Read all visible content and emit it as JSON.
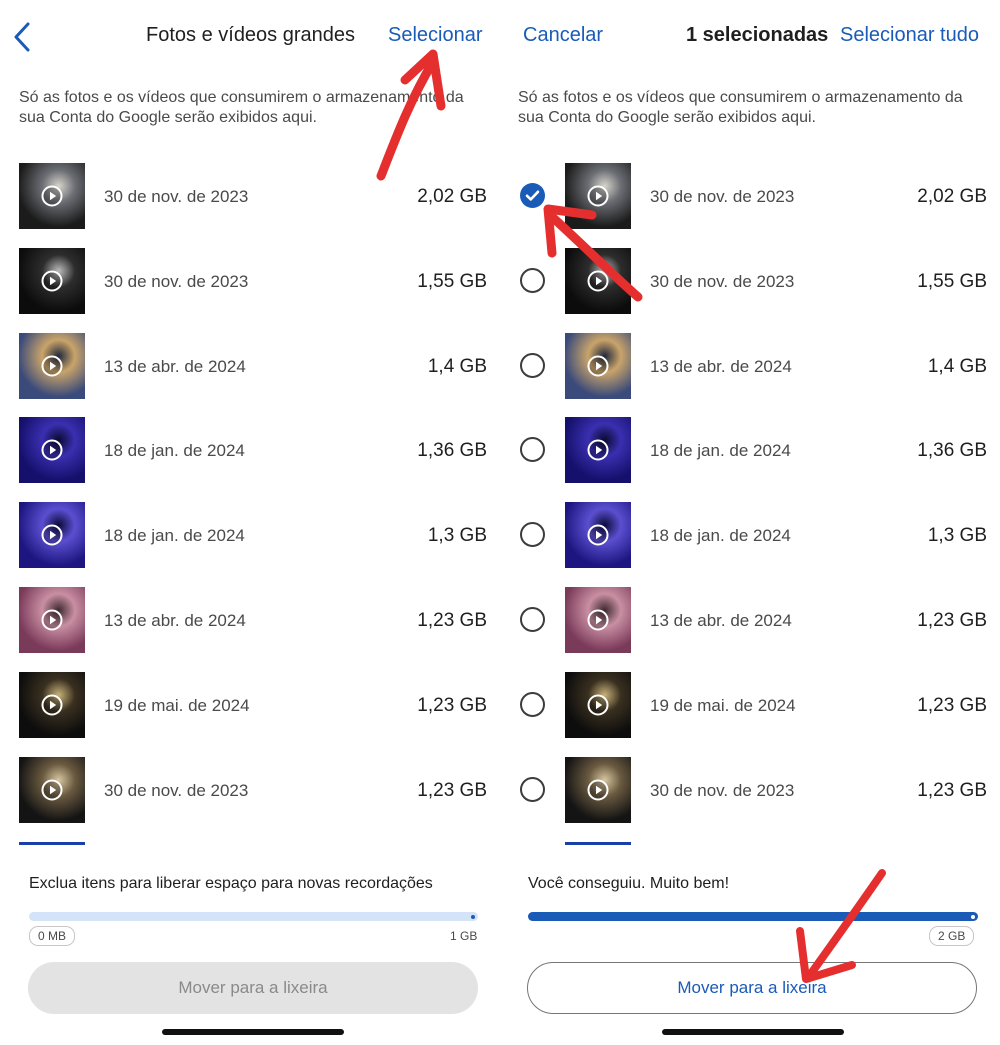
{
  "left": {
    "title": "Fotos e vídeos grandes",
    "select_label": "Selecionar",
    "description": "Só as fotos e os vídeos que consumirem o armazenamento da sua Conta do Google serão exibidos aqui.",
    "status": "Exclua itens para liberar espaço para novas recordações",
    "bar_fill_fraction": 0.0,
    "bar_min_label": "0 MB",
    "bar_max_label": "1 GB",
    "trash_label": "Mover para a lixeira"
  },
  "right": {
    "cancel_label": "Cancelar",
    "title": "1 selecionadas",
    "select_all_label": "Selecionar tudo",
    "description": "Só as fotos e os vídeos que consumirem o armazenamento da sua Conta do Google serão exibidos aqui.",
    "status": "Você conseguiu. Muito bem!",
    "bar_fill_fraction": 1.0,
    "bar_max_label": "2 GB",
    "trash_label": "Mover para a lixeira"
  },
  "items": [
    {
      "date": "30 de nov. de 2023",
      "size": "2,02 GB",
      "selected": true,
      "thumb_colors": [
        "#1b1b1b",
        "#6b6e74",
        "#d8d4cc"
      ]
    },
    {
      "date": "30 de nov. de 2023",
      "size": "1,55 GB",
      "selected": false,
      "thumb_colors": [
        "#0c0c0c",
        "#2d2d2d",
        "#bcbcbc"
      ]
    },
    {
      "date": "13 de abr. de 2024",
      "size": "1,4 GB",
      "selected": false,
      "thumb_colors": [
        "#3a4a7a",
        "#c9a46a",
        "#21283d"
      ]
    },
    {
      "date": "18 de jan. de 2024",
      "size": "1,36 GB",
      "selected": false,
      "thumb_colors": [
        "#14106b",
        "#3a2fb0",
        "#0a0a30"
      ]
    },
    {
      "date": "18 de jan. de 2024",
      "size": "1,3 GB",
      "selected": false,
      "thumb_colors": [
        "#1d1680",
        "#5b4fd0",
        "#0b0a3a"
      ]
    },
    {
      "date": "13 de abr. de 2024",
      "size": "1,23 GB",
      "selected": false,
      "thumb_colors": [
        "#7a3a5a",
        "#c98fa2",
        "#3d2a30"
      ]
    },
    {
      "date": "19 de mai. de 2024",
      "size": "1,23 GB",
      "selected": false,
      "thumb_colors": [
        "#0d0d0d",
        "#3a3020",
        "#c8b27a"
      ]
    },
    {
      "date": "30 de nov. de 2023",
      "size": "1,23 GB",
      "selected": false,
      "thumb_colors": [
        "#141414",
        "#6a5a40",
        "#d8c6a0"
      ]
    }
  ],
  "colors": {
    "accent": "#1a5bb8",
    "annotation_arrow": "#e52f2f"
  },
  "icons": {
    "back": "chevron-left-icon",
    "play": "play-circle-icon",
    "check": "check-circle-icon",
    "radio": "radio-empty-icon"
  }
}
